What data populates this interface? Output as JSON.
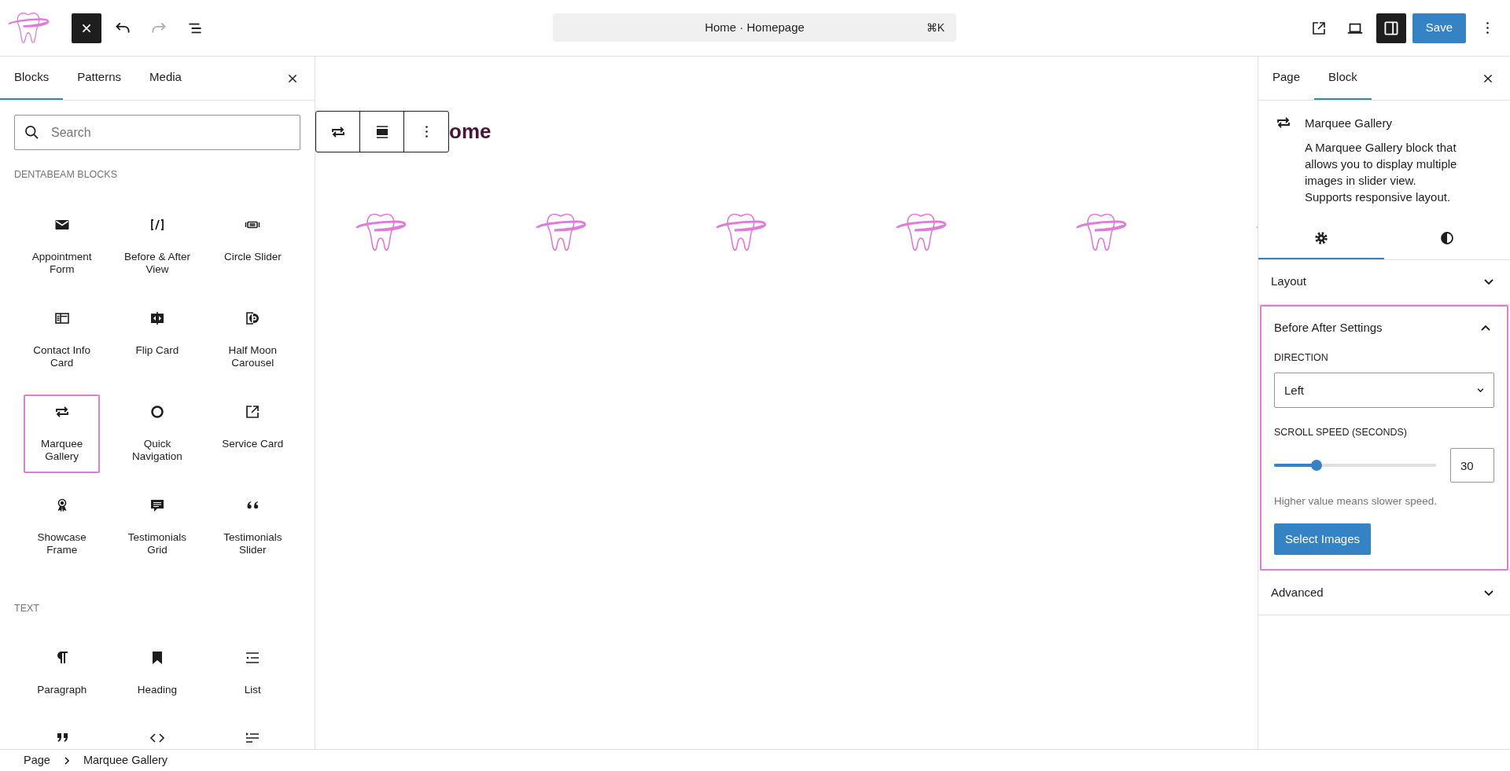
{
  "top_bar": {
    "inserter_toggle": {
      "pressed": true
    },
    "history": {
      "undo_disabled": false,
      "redo_disabled": true
    },
    "command_bar": {
      "title": "Home · Homepage",
      "shortcut": "⌘K"
    },
    "settings_toggle": {
      "pressed": true
    },
    "save_button": "Save"
  },
  "inserter": {
    "tabs": [
      {
        "label": "Blocks",
        "selected": true
      },
      {
        "label": "Patterns",
        "selected": false
      },
      {
        "label": "Media",
        "selected": false
      }
    ],
    "search": {
      "placeholder": "Search"
    },
    "categories": [
      {
        "title": "DENTABEAM BLOCKS",
        "blocks": [
          {
            "label": "Appointment Form",
            "highlighted": false
          },
          {
            "label": "Before & After View",
            "highlighted": false
          },
          {
            "label": "Circle Slider",
            "highlighted": false
          },
          {
            "label": "Contact Info Card",
            "highlighted": false
          },
          {
            "label": "Flip Card",
            "highlighted": false
          },
          {
            "label": "Half Moon Carousel",
            "highlighted": false
          },
          {
            "label": "Marquee Gallery",
            "highlighted": true
          },
          {
            "label": "Quick Navigation",
            "highlighted": false
          },
          {
            "label": "Service Card",
            "highlighted": false
          },
          {
            "label": "Showcase Frame",
            "highlighted": false
          },
          {
            "label": "Testimonials Grid",
            "highlighted": false
          },
          {
            "label": "Testimonials Slider",
            "highlighted": false
          }
        ]
      },
      {
        "title": "TEXT",
        "blocks": [
          {
            "label": "Paragraph",
            "highlighted": false
          },
          {
            "label": "Heading",
            "highlighted": false
          },
          {
            "label": "List",
            "highlighted": false
          },
          {
            "highlighted": false
          },
          {
            "highlighted": false
          },
          {
            "highlighted": false
          }
        ]
      }
    ]
  },
  "canvas": {
    "heading": "ome"
  },
  "sidebar": {
    "tabs": [
      {
        "label": "Page",
        "selected": false
      },
      {
        "label": "Block",
        "selected": true
      }
    ],
    "block": {
      "title": "Marquee Gallery",
      "description": "A Marquee Gallery block that allows you to display multiple images in slider view. Supports responsive layout."
    },
    "style_tabs": [
      {
        "selected": true
      },
      {
        "selected": false
      }
    ],
    "panels": [
      {
        "title": "Layout",
        "expanded": false,
        "highlighted": false
      },
      {
        "title": "Before After Settings",
        "expanded": true,
        "highlighted": true,
        "direction": {
          "label": "DIRECTION",
          "value": "Left"
        },
        "scroll_speed": {
          "label": "SCROLL SPEED (SECONDS)",
          "level": 0.26,
          "value": "30",
          "help": "Higher value means slower speed."
        },
        "button": "Select Images"
      },
      {
        "title": "Advanced",
        "expanded": false,
        "highlighted": false
      }
    ]
  },
  "breadcrumb": [
    "Page",
    "Marquee Gallery"
  ]
}
